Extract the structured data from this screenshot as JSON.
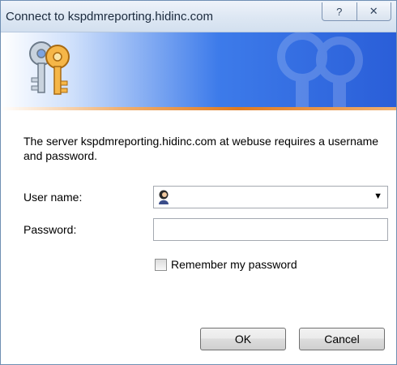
{
  "window": {
    "title": "Connect to kspdmreporting.hidinc.com",
    "help_glyph": "?",
    "close_glyph": "✕"
  },
  "dialog": {
    "message": "The server kspdmreporting.hidinc.com at webuse requires a username and password.",
    "username_label": "User name:",
    "username_value": "",
    "password_label": "Password:",
    "password_value": "",
    "remember_label": "Remember my password",
    "remember_checked": false,
    "ok_label": "OK",
    "cancel_label": "Cancel"
  },
  "icons": {
    "banner": "keys-icon",
    "user": "user-icon",
    "dropdown": "chevron-down-icon"
  },
  "colors": {
    "banner_blue": "#2a5ed8",
    "banner_stripe": "#e07a1f"
  }
}
